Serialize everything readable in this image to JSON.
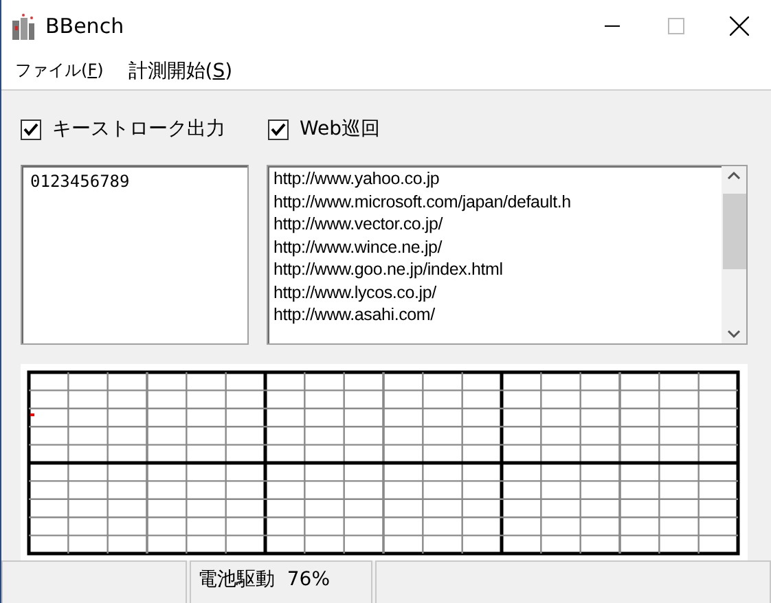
{
  "window": {
    "title": "BBench"
  },
  "menu": [
    {
      "before": "ファイル(",
      "accel": "F",
      "after": ")"
    },
    {
      "before": "計測開始(",
      "accel": "S",
      "after": ")"
    }
  ],
  "options": [
    {
      "label": "キーストローク出力",
      "checked": true
    },
    {
      "label": "Web巡回",
      "checked": true
    }
  ],
  "keystroke_text": "0123456789",
  "urls": [
    "http://www.yahoo.co.jp",
    "http://www.microsoft.com/japan/default.h",
    "http://www.vector.co.jp/",
    "http://www.wince.ne.jp/",
    "http://www.goo.ne.jp/index.html",
    "http://www.lycos.co.jp/",
    "http://www.asahi.com/"
  ],
  "status_bar": {
    "battery": "電池駆動  76%"
  }
}
